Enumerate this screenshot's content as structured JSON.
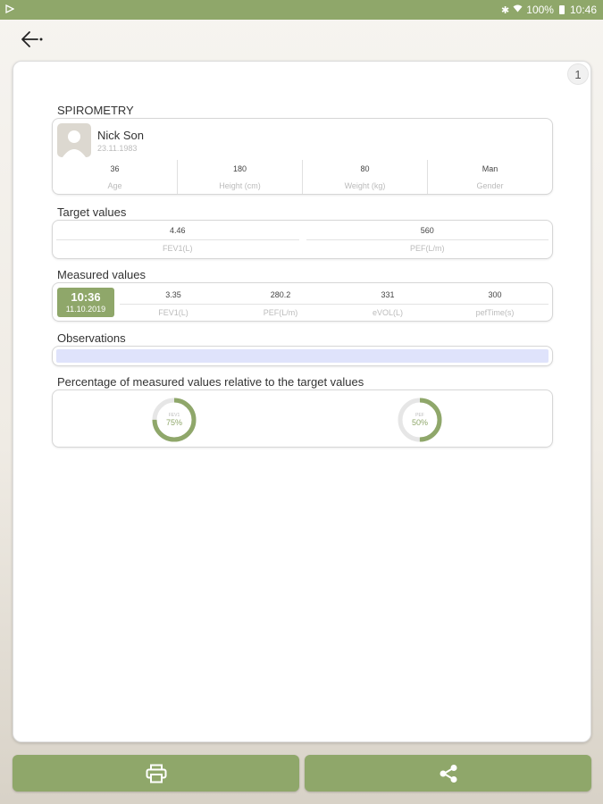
{
  "status_bar": {
    "battery_text": "100%",
    "time": "10:46"
  },
  "header": {
    "back_icon": "back-arrow-icon",
    "page_number": "1"
  },
  "spirometry": {
    "title": "SPIROMETRY",
    "patient": {
      "name": "Nick Son",
      "dob": "23.11.1983"
    },
    "stats": [
      {
        "value": "36",
        "label": "Age"
      },
      {
        "value": "180",
        "label": "Height (cm)"
      },
      {
        "value": "80",
        "label": "Weight (kg)"
      },
      {
        "value": "Man",
        "label": "Gender"
      }
    ]
  },
  "target": {
    "title": "Target values",
    "items": [
      {
        "value": "4.46",
        "label": "FEV1(L)"
      },
      {
        "value": "560",
        "label": "PEF(L/m)"
      }
    ]
  },
  "measured": {
    "title": "Measured values",
    "time": "10:36",
    "date": "11.10.2019",
    "items": [
      {
        "value": "3.35",
        "label": "FEV1(L)"
      },
      {
        "value": "280.2",
        "label": "PEF(L/m)"
      },
      {
        "value": "331",
        "label": "eVOL(L)"
      },
      {
        "value": "300",
        "label": "pefTime(s)"
      }
    ]
  },
  "observations": {
    "title": "Observations",
    "value": ""
  },
  "percentage": {
    "title": "Percentage of measured values relative to the target values",
    "gauges": [
      {
        "label": "FEV1",
        "value_text": "75%",
        "value": 75
      },
      {
        "label": "PEF",
        "value_text": "50%",
        "value": 50
      }
    ]
  },
  "actions": {
    "print_icon": "printer-icon",
    "share_icon": "share-icon"
  },
  "colors": {
    "accent": "#8fa76a",
    "gauge_track": "#e6e6e6",
    "observation_bg": "#dfe3fb"
  }
}
